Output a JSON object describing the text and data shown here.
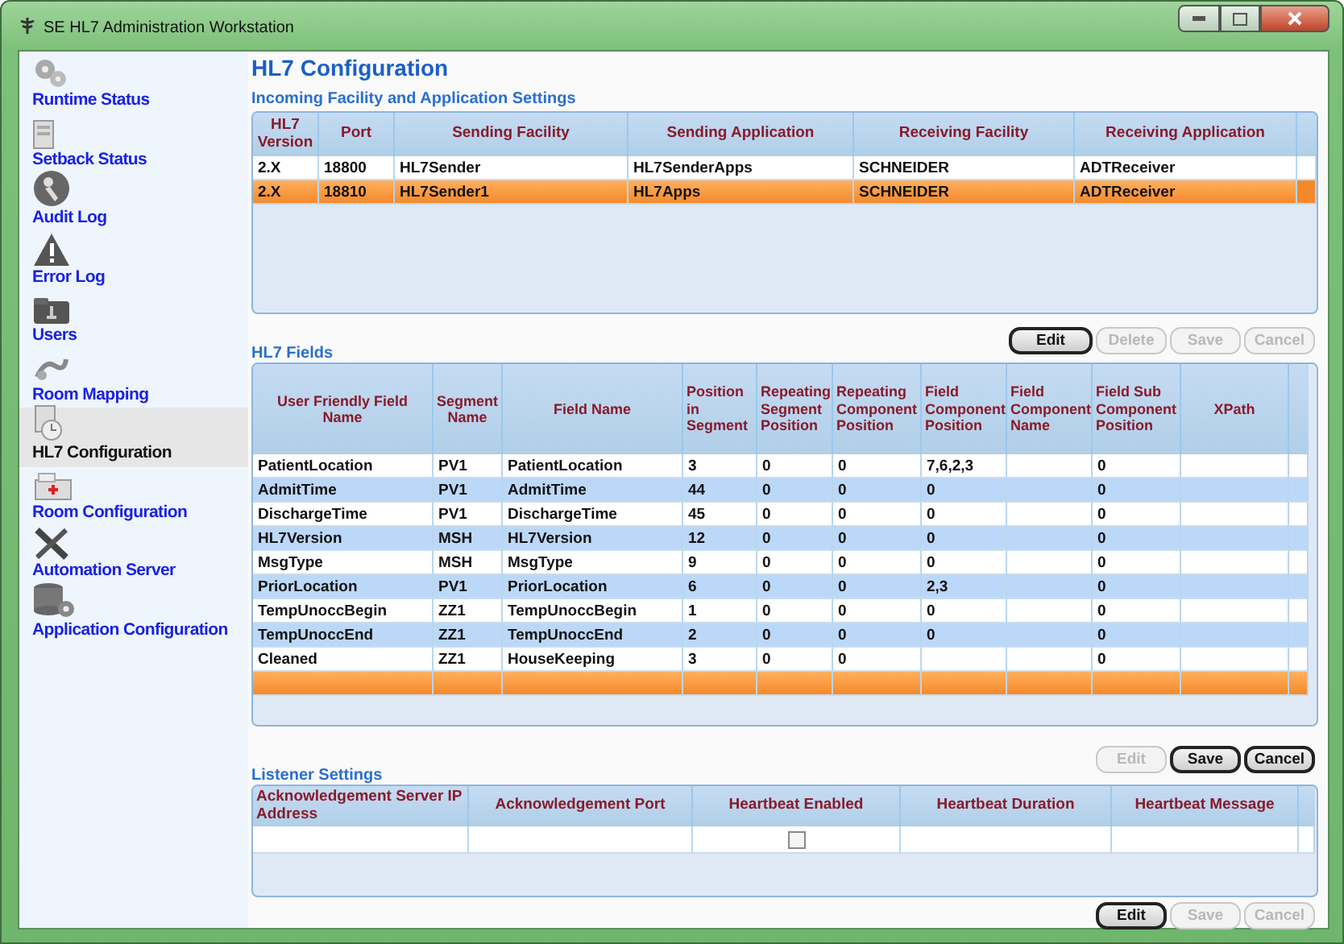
{
  "window": {
    "title": "SE HL7 Administration Workstation"
  },
  "sidebar": {
    "items": [
      {
        "label": "Runtime Status",
        "selected": false
      },
      {
        "label": "Setback Status",
        "selected": false
      },
      {
        "label": "Audit Log",
        "selected": false
      },
      {
        "label": "Error Log",
        "selected": false
      },
      {
        "label": "Users",
        "selected": false
      },
      {
        "label": "Room Mapping",
        "selected": false
      },
      {
        "label": "HL7 Configuration",
        "selected": true
      },
      {
        "label": "Room Configuration",
        "selected": false
      },
      {
        "label": "Automation Server",
        "selected": false
      },
      {
        "label": "Application Configuration",
        "selected": false
      }
    ]
  },
  "page_title": "HL7 Configuration",
  "incoming": {
    "title": "Incoming Facility and Application Settings",
    "columns": [
      "HL7 Version",
      "Port",
      "Sending Facility",
      "Sending Application",
      "Receiving Facility",
      "Receiving Application"
    ],
    "rows": [
      {
        "cells": [
          "2.X",
          "18800",
          "HL7Sender",
          "HL7SenderApps",
          "SCHNEIDER",
          "ADTReceiver"
        ],
        "selected": false
      },
      {
        "cells": [
          "2.X",
          "18810",
          "HL7Sender1",
          "HL7Apps",
          "SCHNEIDER",
          "ADTReceiver"
        ],
        "selected": true
      }
    ],
    "buttons": [
      {
        "label": "Edit",
        "disabled": false
      },
      {
        "label": "Delete",
        "disabled": true
      },
      {
        "label": "Save",
        "disabled": true
      },
      {
        "label": "Cancel",
        "disabled": true
      }
    ]
  },
  "fields": {
    "title": "HL7 Fields",
    "columns": [
      "User Friendly Field Name",
      "Segment Name",
      "Field Name",
      "Position in Segment",
      "Repeating Segment Position",
      "Repeating Component Position",
      "Field Component Position",
      "Field Component Name",
      "Field Sub Component Position",
      "XPath"
    ],
    "rows": [
      {
        "cells": [
          "PatientLocation",
          "PV1",
          "PatientLocation",
          "3",
          "0",
          "0",
          "7,6,2,3",
          null,
          "0",
          null
        ],
        "selected": false
      },
      {
        "cells": [
          "AdmitTime",
          "PV1",
          "AdmitTime",
          "44",
          "0",
          "0",
          "0",
          null,
          "0",
          null
        ],
        "selected": false
      },
      {
        "cells": [
          "DischargeTime",
          "PV1",
          "DischargeTime",
          "45",
          "0",
          "0",
          "0",
          null,
          "0",
          null
        ],
        "selected": false
      },
      {
        "cells": [
          "HL7Version",
          "MSH",
          "HL7Version",
          "12",
          "0",
          "0",
          "0",
          null,
          "0",
          null
        ],
        "selected": false
      },
      {
        "cells": [
          "MsgType",
          "MSH",
          "MsgType",
          "9",
          "0",
          "0",
          "0",
          null,
          "0",
          null
        ],
        "selected": false
      },
      {
        "cells": [
          "PriorLocation",
          "PV1",
          "PriorLocation",
          "6",
          "0",
          "0",
          "2,3",
          null,
          "0",
          null
        ],
        "selected": false
      },
      {
        "cells": [
          "TempUnoccBegin",
          "ZZ1",
          "TempUnoccBegin",
          "1",
          "0",
          "0",
          "0",
          null,
          "0",
          null
        ],
        "selected": false
      },
      {
        "cells": [
          "TempUnoccEnd",
          "ZZ1",
          "TempUnoccEnd",
          "2",
          "0",
          "0",
          "0",
          null,
          "0",
          null
        ],
        "selected": false
      },
      {
        "cells": [
          "Cleaned",
          "ZZ1",
          "HouseKeeping",
          "3",
          "0",
          "0",
          null,
          null,
          "0",
          null
        ],
        "selected": false
      }
    ],
    "new_row": {
      "selected": true
    },
    "buttons": [
      {
        "label": "Edit",
        "disabled": true
      },
      {
        "label": "Save",
        "disabled": false
      },
      {
        "label": "Cancel",
        "disabled": false
      }
    ]
  },
  "listener": {
    "title": "Listener Settings",
    "columns": [
      "Acknowledgement Server IP Address",
      "Acknowledgement Port",
      "Heartbeat Enabled",
      "Heartbeat Duration",
      "Heartbeat Message"
    ],
    "heartbeat_enabled": {
      "checked": false
    },
    "buttons": [
      {
        "label": "Edit",
        "disabled": false
      },
      {
        "label": "Save",
        "disabled": true
      },
      {
        "label": "Cancel",
        "disabled": true
      }
    ]
  }
}
